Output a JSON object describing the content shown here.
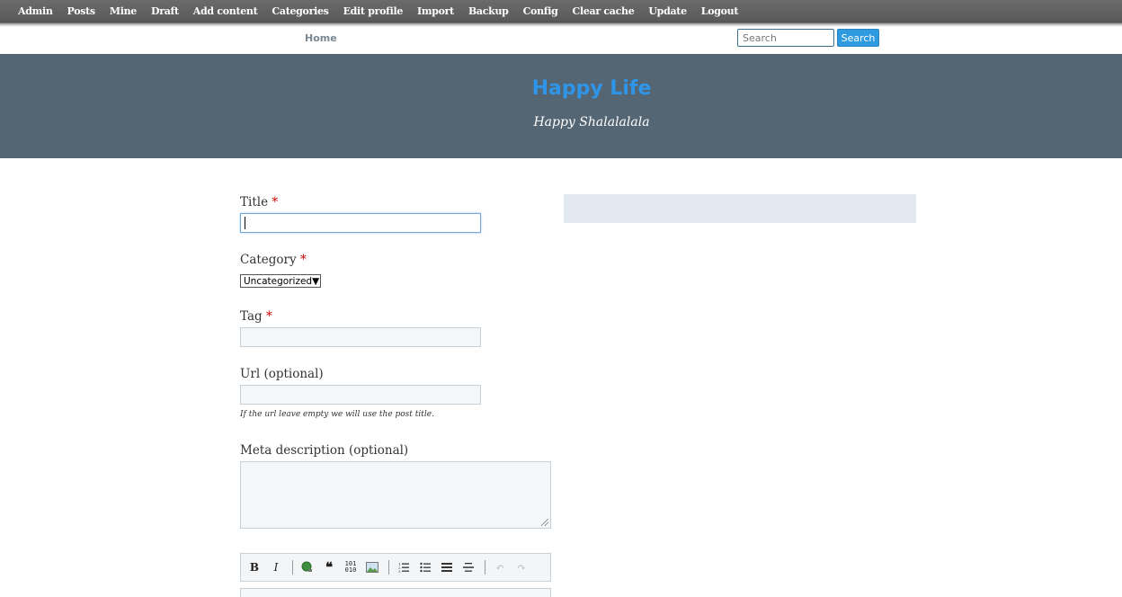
{
  "admin_bar": {
    "items": [
      "Admin",
      "Posts",
      "Mine",
      "Draft",
      "Add content",
      "Categories",
      "Edit profile",
      "Import",
      "Backup",
      "Config",
      "Clear cache",
      "Update",
      "Logout"
    ]
  },
  "nav": {
    "home_label": "Home",
    "search_placeholder": "Search",
    "search_button": "Search"
  },
  "header": {
    "site_title": "Happy Life",
    "tagline": "Happy Shalalalala"
  },
  "form": {
    "title_label": "Title",
    "category_label": "Category",
    "category_selected": "Uncategorized",
    "tag_label": "Tag",
    "url_label": "Url (optional)",
    "url_hint": "If the url leave empty we will use the post title.",
    "meta_label": "Meta description (optional)",
    "required_mark": "*"
  },
  "editor_toolbar": {
    "buttons": [
      "bold-icon",
      "italic-icon",
      "link-icon",
      "quote-icon",
      "code-icon",
      "image-icon",
      "ordered-list-icon",
      "unordered-list-icon",
      "heading-icon",
      "horizontal-rule-icon",
      "undo-icon",
      "redo-icon"
    ]
  }
}
